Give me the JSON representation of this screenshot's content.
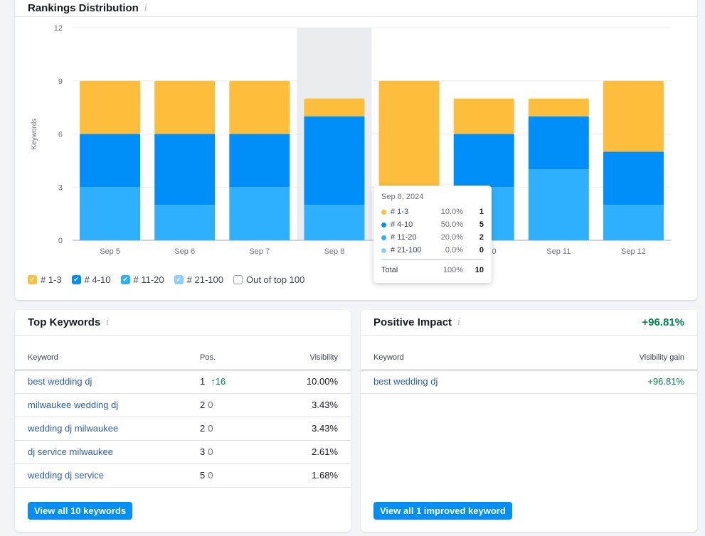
{
  "rankings": {
    "title": "Rankings Distribution",
    "info_icon": "i",
    "legend": [
      {
        "label": "# 1-3",
        "color": "#fcbe3c",
        "checked": true
      },
      {
        "label": "# 4-10",
        "color": "#008ff8",
        "checked": true
      },
      {
        "label": "# 11-20",
        "color": "#2eb0fd",
        "checked": true
      },
      {
        "label": "# 21-100",
        "color": "#8dccfd",
        "checked": true
      },
      {
        "label": "Out of top 100",
        "color": "#ffffff",
        "checked": false
      }
    ],
    "tooltip": {
      "date": "Sep 8, 2024",
      "rows": [
        {
          "label": "# 1-3",
          "pct": "10.0%",
          "value": "1",
          "color": "#fcbe3c"
        },
        {
          "label": "# 4-10",
          "pct": "50.0%",
          "value": "5",
          "color": "#008ff8"
        },
        {
          "label": "# 11-20",
          "pct": "20.0%",
          "value": "2",
          "color": "#2eb0fd"
        },
        {
          "label": "# 21-100",
          "pct": "0.0%",
          "value": "0",
          "color": "#8dccfd"
        }
      ],
      "total_label": "Total",
      "total_pct": "100%",
      "total_value": "10"
    }
  },
  "chart_data": {
    "type": "bar",
    "stacked": true,
    "title": "Rankings Distribution",
    "xlabel": "",
    "ylabel": "Keywords",
    "ylim": [
      0,
      12
    ],
    "yticks": [
      0,
      3,
      6,
      9,
      12
    ],
    "grid": true,
    "legend_position": "bottom-left",
    "highlighted_category": "Sep 8",
    "categories": [
      "Sep 5",
      "Sep 6",
      "Sep 7",
      "Sep 8",
      "Sep 9",
      "Sep 10",
      "Sep 11",
      "Sep 12"
    ],
    "series": [
      {
        "name": "# 11-20",
        "color": "#2eb0fd",
        "values": [
          3,
          2,
          3,
          2,
          0,
          3,
          4,
          2
        ]
      },
      {
        "name": "# 4-10",
        "color": "#008ff8",
        "values": [
          3,
          4,
          3,
          5,
          0,
          3,
          3,
          3
        ]
      },
      {
        "name": "# 1-3",
        "color": "#fcbe3c",
        "values": [
          3,
          3,
          3,
          1,
          9,
          2,
          1,
          4
        ]
      },
      {
        "name": "# 21-100",
        "color": "#8dccfd",
        "values": [
          0,
          0,
          0,
          0,
          0,
          0,
          0,
          0
        ]
      }
    ]
  },
  "top_keywords": {
    "title": "Top Keywords",
    "info_icon": "i",
    "columns": [
      "Keyword",
      "Pos.",
      "Visibility"
    ],
    "rows": [
      {
        "keyword": "best wedding dj",
        "pos": "1",
        "change": "16",
        "change_dir": "up",
        "visibility": "10.00%"
      },
      {
        "keyword": "milwaukee wedding dj",
        "pos": "2",
        "change": "0",
        "change_dir": "none",
        "visibility": "3.43%"
      },
      {
        "keyword": "wedding dj milwaukee",
        "pos": "2",
        "change": "0",
        "change_dir": "none",
        "visibility": "3.43%"
      },
      {
        "keyword": "dj service milwaukee",
        "pos": "3",
        "change": "0",
        "change_dir": "none",
        "visibility": "2.61%"
      },
      {
        "keyword": "wedding dj service",
        "pos": "5",
        "change": "0",
        "change_dir": "none",
        "visibility": "1.68%"
      }
    ],
    "button": "View all 10 keywords"
  },
  "positive_impact": {
    "title": "Positive Impact",
    "info_icon": "i",
    "total": "+96.81%",
    "columns": [
      "Keyword",
      "Visibility gain"
    ],
    "rows": [
      {
        "keyword": "best wedding dj",
        "gain": "+96.81%"
      }
    ],
    "button": "View all 1 improved keyword"
  }
}
